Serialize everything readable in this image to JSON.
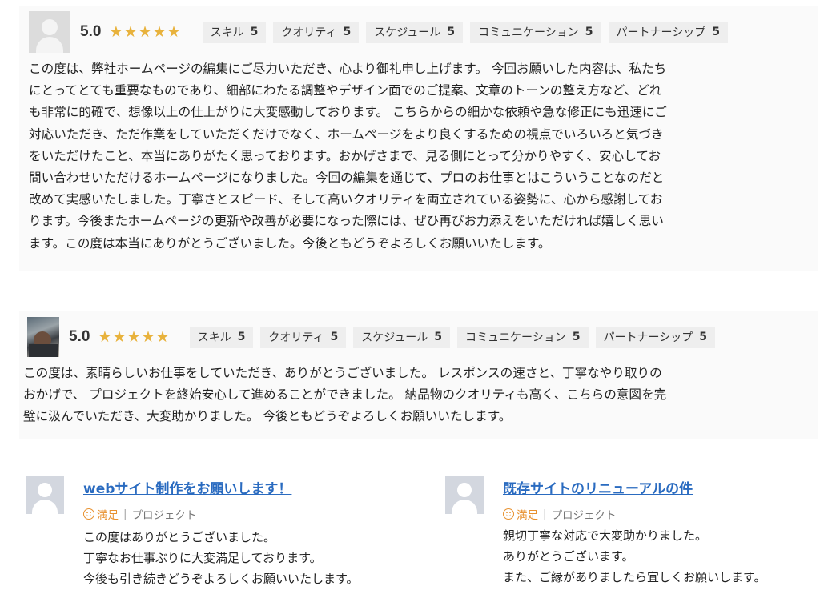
{
  "reviews": [
    {
      "score": "5.0",
      "stars": "★★★★★",
      "tags": [
        {
          "label": "スキル",
          "score": "5"
        },
        {
          "label": "クオリティ",
          "score": "5"
        },
        {
          "label": "スケジュール",
          "score": "5"
        },
        {
          "label": "コミュニケーション",
          "score": "5"
        },
        {
          "label": "パートナーシップ",
          "score": "5"
        }
      ],
      "text": "この度は、弊社ホームページの編集にご尽力いただき、心より御礼申し上げます。 今回お願いした内容は、私たち\nにとってとても重要なものであり、細部にわたる調整やデザイン面でのご提案、文章のトーンの整え方など、どれ\nも非常に的確で、想像以上の仕上がりに大変感動しております。 こちらからの細かな依頼や急な修正にも迅速にご\n対応いただき、ただ作業をしていただくだけでなく、ホームページをより良くするための視点でいろいろと気づき\nをいただけたこと、本当にありがたく思っております。おかげさまで、見る側にとって分かりやすく、安心してお\n問い合わせいただけるホームページになりました。今回の編集を通じて、プロのお仕事とはこういうことなのだと\n改めて実感いたしました。丁寧さとスピード、そして高いクオリティを両立されている姿勢に、心から感謝してお\nります。今後またホームページの更新や改善が必要になった際には、ぜひ再びお力添えをいただければ嬉しく思い\nます。この度は本当にありがとうございました。今後ともどうぞよろしくお願いいたします。"
    },
    {
      "score": "5.0",
      "stars": "★★★★★",
      "tags": [
        {
          "label": "スキル",
          "score": "5"
        },
        {
          "label": "クオリティ",
          "score": "5"
        },
        {
          "label": "スケジュール",
          "score": "5"
        },
        {
          "label": "コミュニケーション",
          "score": "5"
        },
        {
          "label": "パートナーシップ",
          "score": "5"
        }
      ],
      "text": "この度は、素晴らしいお仕事をしていただき、ありがとうございました。 レスポンスの速さと、丁寧なやり取りの\nおかげで、 プロジェクトを終始安心して進めることができました。 納品物のクオリティも高く、こちらの意図を完\n璧に汲んでいただき、大変助かりました。 今後ともどうぞよろしくお願いいたします。"
    }
  ],
  "cards": [
    {
      "title": "webサイト制作をお願いします！",
      "rating": "満足",
      "category": "プロジェクト",
      "lines": [
        "この度はありがとうございました。",
        "丁寧なお仕事ぶりに大変満足しております。",
        "今後も引き続きどうぞよろしくお願いいたします。"
      ]
    },
    {
      "title": "既存サイトのリニューアルの件",
      "rating": "満足",
      "category": "プロジェクト",
      "lines": [
        "親切丁寧な対応で大変助かりました。",
        "ありがとうございます。",
        "また、ご縁がありましたら宜しくお願いします。"
      ]
    }
  ],
  "colors": {
    "star": "#e8b23c",
    "link": "#2a6bc0",
    "satisfied": "#e8912f"
  },
  "icons": {
    "default_avatar": "user-silhouette-icon",
    "photo_avatar": "user-photo-avatar",
    "satisfied": "smile-icon"
  }
}
